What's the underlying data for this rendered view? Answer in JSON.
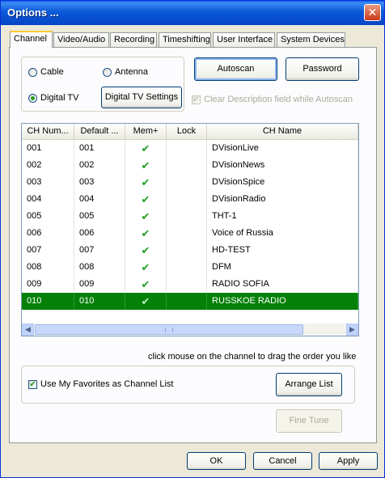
{
  "window": {
    "title": "Options ...",
    "close_label": "✕"
  },
  "tabs": [
    "Channel",
    "Video/Audio",
    "Recording",
    "Timeshifting",
    "User Interface",
    "System Devices"
  ],
  "source": {
    "cable": "Cable",
    "antenna": "Antenna",
    "digital_tv": "Digital TV",
    "selected": "Digital TV"
  },
  "buttons": {
    "digital_tv_settings": "Digital TV Settings",
    "autoscan": "Autoscan",
    "password": "Password",
    "arrange_list": "Arrange List",
    "fine_tune": "Fine Tune",
    "ok": "OK",
    "cancel": "Cancel",
    "apply": "Apply"
  },
  "clear_desc": {
    "label": "Clear Description field while Autoscan",
    "checked": true,
    "disabled": true
  },
  "list": {
    "columns": [
      "CH Num...",
      "Default ...",
      "Mem+",
      "Lock",
      "CH Name"
    ],
    "rows": [
      [
        "001",
        "001",
        "✔",
        "",
        "DVisionLive"
      ],
      [
        "002",
        "002",
        "✔",
        "",
        "DVisionNews"
      ],
      [
        "003",
        "003",
        "✔",
        "",
        "DVisionSpice"
      ],
      [
        "004",
        "004",
        "✔",
        "",
        "DVisionRadio"
      ],
      [
        "005",
        "005",
        "✔",
        "",
        "THT-1"
      ],
      [
        "006",
        "006",
        "✔",
        "",
        "Voice of Russia"
      ],
      [
        "007",
        "007",
        "✔",
        "",
        "HD-TEST"
      ],
      [
        "008",
        "008",
        "✔",
        "",
        "DFM"
      ],
      [
        "009",
        "009",
        "✔",
        "",
        "RADIO SOFIA"
      ],
      [
        "010",
        "010",
        "✔",
        "",
        "RUSSKOE RADIO"
      ]
    ],
    "selected_row": 9
  },
  "hint": "click mouse on the channel to drag the order you like",
  "favorites": {
    "label": "Use My Favorites as Channel List",
    "checked": true
  },
  "colors": {
    "selection": "#058008",
    "check": "#21a121",
    "title": "#0546c8"
  }
}
